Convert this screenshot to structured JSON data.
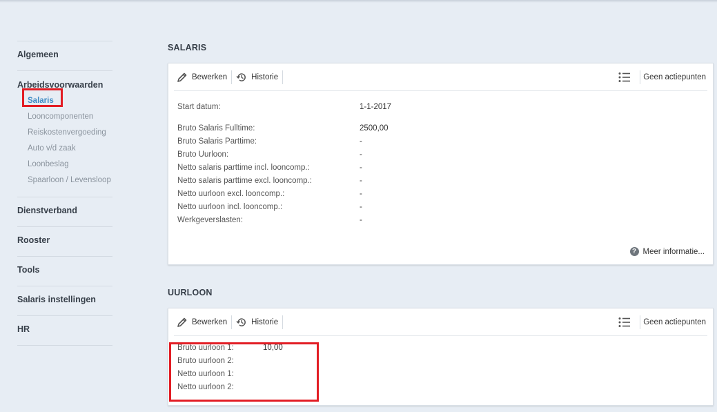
{
  "sidebar": {
    "groups": [
      {
        "label": "Algemeen"
      },
      {
        "label": "Arbeidsvoorwaarden",
        "items": [
          "Salaris",
          "Looncomponenten",
          "Reiskostenvergoeding",
          "Auto v/d zaak",
          "Loonbeslag",
          "Spaarloon / Levensloop"
        ]
      },
      {
        "label": "Dienstverband"
      },
      {
        "label": "Rooster"
      },
      {
        "label": "Tools"
      },
      {
        "label": "Salaris instellingen"
      },
      {
        "label": "HR"
      }
    ],
    "active_item": "Salaris"
  },
  "salaris": {
    "title": "SALARIS",
    "toolbar": {
      "edit": "Bewerken",
      "history": "Historie",
      "actions": "Geen actiepunten"
    },
    "start": {
      "label": "Start datum:",
      "value": "1-1-2017"
    },
    "rows": [
      {
        "label": "Bruto Salaris Fulltime:",
        "value": "2500,00"
      },
      {
        "label": "Bruto Salaris Parttime:",
        "value": "-"
      },
      {
        "label": "Bruto Uurloon:",
        "value": "-"
      },
      {
        "label": "Netto salaris parttime incl. looncomp.:",
        "value": "-"
      },
      {
        "label": "Netto salaris parttime excl. looncomp.:",
        "value": "-"
      },
      {
        "label": "Netto uurloon excl. looncomp.:",
        "value": "-"
      },
      {
        "label": "Netto uurloon incl. looncomp.:",
        "value": "-"
      },
      {
        "label": "Werkgeverslasten:",
        "value": "-"
      }
    ],
    "more": "Meer informatie..."
  },
  "uurloon": {
    "title": "UURLOON",
    "toolbar": {
      "edit": "Bewerken",
      "history": "Historie",
      "actions": "Geen actiepunten"
    },
    "rows": [
      {
        "label": "Bruto uurloon 1:",
        "value": "10,00"
      },
      {
        "label": "Bruto uurloon 2:",
        "value": ""
      },
      {
        "label": "Netto uurloon 1:",
        "value": ""
      },
      {
        "label": "Netto uurloon 2:",
        "value": ""
      }
    ]
  },
  "colors": {
    "background": "#e7edf4",
    "highlight": "#e21d24",
    "active_link": "#3c8ac4"
  }
}
